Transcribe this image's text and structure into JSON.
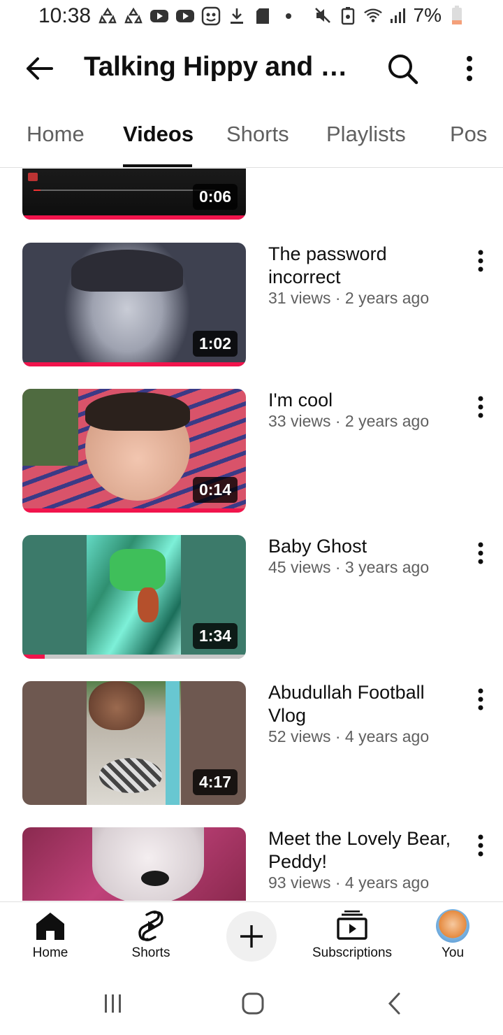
{
  "status_bar": {
    "time": "10:38",
    "battery_text": "7%",
    "battery_color": "#f4a07a"
  },
  "app_bar": {
    "title": "Talking Hippy and Fr...",
    "back_icon": "arrow-left-icon",
    "search_icon": "search-icon",
    "more_icon": "more-vert-icon"
  },
  "tabs": [
    {
      "label": "Home",
      "active": false
    },
    {
      "label": "Videos",
      "active": true
    },
    {
      "label": "Shorts",
      "active": false
    },
    {
      "label": "Playlists",
      "active": false
    },
    {
      "label": "Pos",
      "active": false
    }
  ],
  "videos": [
    {
      "title": "",
      "meta": "",
      "duration": "0:06",
      "watched_fraction": 1.0
    },
    {
      "title": "The password incorrect",
      "meta": "31 views · 2 years ago",
      "duration": "1:02",
      "watched_fraction": 1.0
    },
    {
      "title": "I'm cool",
      "meta": "33 views · 2 years ago",
      "duration": "0:14",
      "watched_fraction": 1.0
    },
    {
      "title": "Baby Ghost",
      "meta": "45 views · 3 years ago",
      "duration": "1:34",
      "watched_fraction": 0.1
    },
    {
      "title": "Abudullah Football Vlog",
      "meta": "52 views · 4 years ago",
      "duration": "4:17",
      "watched_fraction": 0.0
    },
    {
      "title": "Meet the Lovely Bear, Peddy!",
      "meta": "93 views · 4 years ago",
      "duration": "",
      "watched_fraction": 0.0
    }
  ],
  "bottom_nav": {
    "home": "Home",
    "shorts": "Shorts",
    "subscriptions": "Subscriptions",
    "you": "You"
  },
  "colors": {
    "accent_red": "#f1144c",
    "text_primary": "#0f0f0f",
    "text_secondary": "#606060"
  }
}
